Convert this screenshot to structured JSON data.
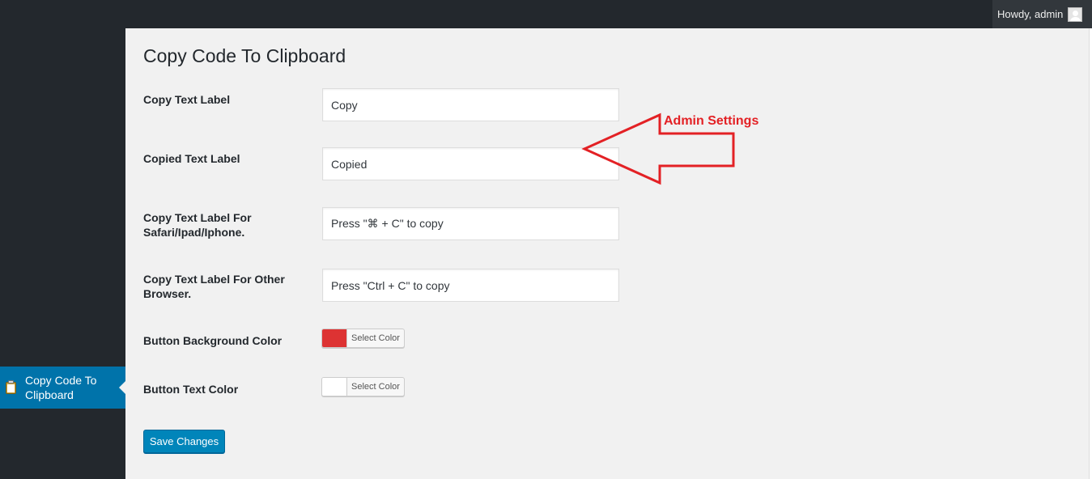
{
  "admin_bar": {
    "greeting": "Howdy, admin"
  },
  "sidebar": {
    "current_item_label": "Copy Code To Clipboard"
  },
  "page": {
    "title": "Copy Code To Clipboard"
  },
  "form": {
    "copy_text_label": {
      "label": "Copy Text Label",
      "value": "Copy"
    },
    "copied_text_label": {
      "label": "Copied Text Label",
      "value": "Copied"
    },
    "safari_label": {
      "label": "Copy Text Label For Safari/Ipad/Iphone.",
      "value": "Press \"⌘ + C\" to copy"
    },
    "other_browser_label": {
      "label": "Copy Text Label For Other Browser.",
      "value": "Press \"Ctrl + C\" to copy"
    },
    "button_bg_color": {
      "label": "Button Background Color",
      "button_text": "Select Color",
      "color": "#dd3333"
    },
    "button_text_color": {
      "label": "Button Text Color",
      "button_text": "Select Color",
      "color": "#ffffff"
    },
    "save_label": "Save Changes"
  },
  "annotation": {
    "text": "Admin Settings",
    "color": "#e32125"
  },
  "colors": {
    "admin_bar": "#23282d",
    "sidebar": "#23282d",
    "menu_current": "#0073aa",
    "content_bg": "#f1f1f1",
    "primary_button": "#0085ba"
  },
  "icons": {
    "avatar": "user-avatar-icon",
    "menu": "clipboard-icon"
  }
}
